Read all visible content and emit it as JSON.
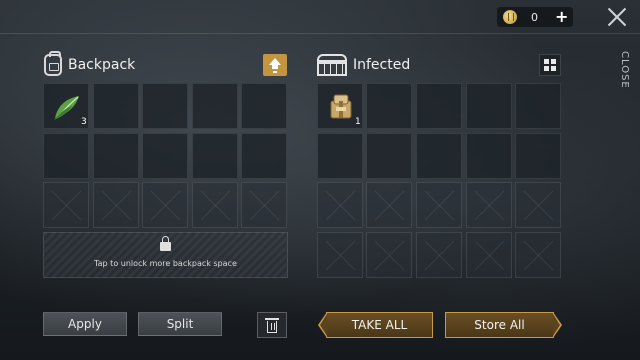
{
  "topbar": {
    "currency_value": "0",
    "close_label": "CLOSE"
  },
  "backpack": {
    "title": "Backpack",
    "items": [
      {
        "name": "herb",
        "qty": "3"
      }
    ],
    "unlock_text": "Tap to unlock more backpack space"
  },
  "container": {
    "title": "Infected",
    "items": [
      {
        "name": "supply-pack",
        "qty": "1"
      }
    ]
  },
  "actions": {
    "apply": "Apply",
    "split": "Split",
    "take_all": "TAKE ALL",
    "store_all": "Store All"
  },
  "colors": {
    "accent_gold": "#c89a45",
    "sort_button": "#c3953f"
  }
}
